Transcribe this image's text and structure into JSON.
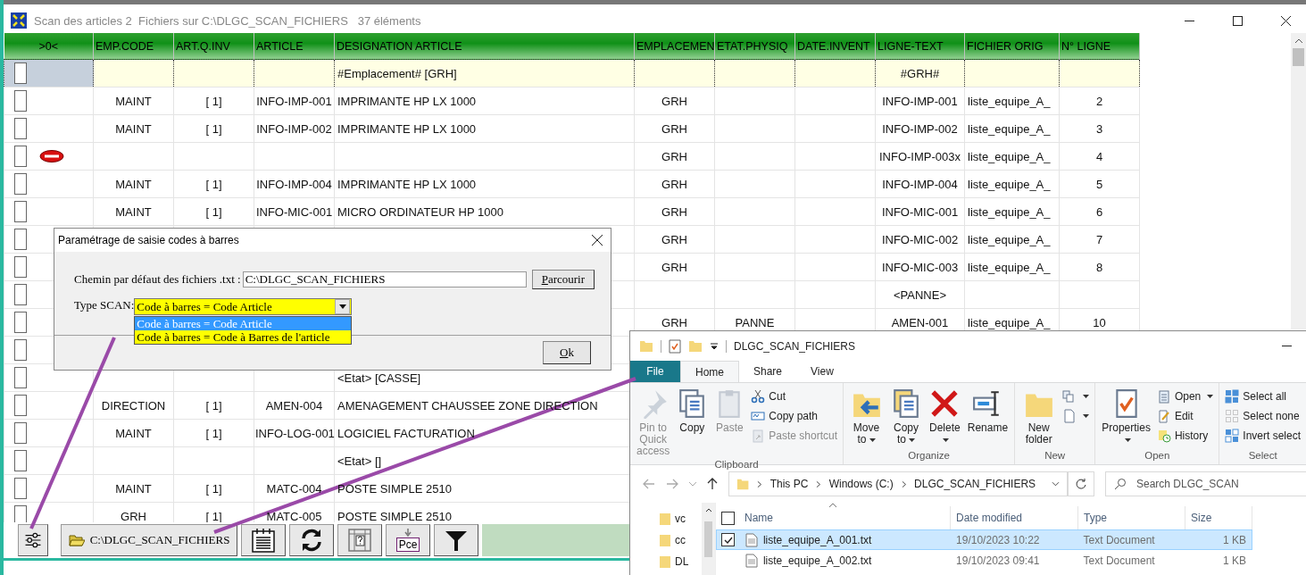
{
  "window": {
    "title": "Scan des articles 2  Fichiers sur C:\\DLGC_SCAN_FICHIERS   37 éléments"
  },
  "table": {
    "columns": [
      ">0<",
      "EMP.CODE",
      "ART.Q.INV",
      "ARTICLE",
      "DESIGNATION ARTICLE",
      "EMPLACEMEN",
      "ETAT.PHYSIQ",
      "DATE.INVENT",
      "LIGNE-TEXT",
      "FICHIER ORIG",
      "N° LIGNE"
    ],
    "rows": [
      {
        "kind": "location",
        "checked": false,
        "error": false,
        "cells": {
          "designation": "#Emplacement# [GRH]",
          "ligne": "#GRH#"
        }
      },
      {
        "kind": "item",
        "checked": false,
        "error": false,
        "cells": {
          "emp": "MAINT",
          "qty": "[ 1]",
          "article": "INFO-IMP-001",
          "designation": "IMPRIMANTE HP LX 1000",
          "place": "GRH",
          "ligne": "INFO-IMP-001",
          "file": "liste_equipe_A_",
          "num": "2"
        }
      },
      {
        "kind": "item",
        "checked": false,
        "error": false,
        "cells": {
          "emp": "MAINT",
          "qty": "[ 1]",
          "article": "INFO-IMP-002",
          "designation": "IMPRIMANTE HP LX 1000",
          "place": "GRH",
          "ligne": "INFO-IMP-002",
          "file": "liste_equipe_A_",
          "num": "3"
        }
      },
      {
        "kind": "item",
        "checked": false,
        "error": true,
        "cells": {
          "place": "GRH",
          "ligne": "INFO-IMP-003x",
          "file": "liste_equipe_A_",
          "num": "4"
        }
      },
      {
        "kind": "item",
        "checked": false,
        "error": false,
        "cells": {
          "emp": "MAINT",
          "qty": "[ 1]",
          "article": "INFO-IMP-004",
          "designation": "IMPRIMANTE HP LX 1000",
          "place": "GRH",
          "ligne": "INFO-IMP-004",
          "file": "liste_equipe_A_",
          "num": "5"
        }
      },
      {
        "kind": "item",
        "checked": false,
        "error": false,
        "cells": {
          "emp": "MAINT",
          "qty": "[ 1]",
          "article": "INFO-MIC-001",
          "designation": "MICRO ORDINATEUR HP 1000",
          "place": "GRH",
          "ligne": "INFO-MIC-001",
          "file": "liste_equipe_A_",
          "num": "6"
        }
      },
      {
        "kind": "item",
        "checked": false,
        "error": false,
        "cells": {
          "place": "GRH",
          "ligne": "INFO-MIC-002",
          "file": "liste_equipe_A_",
          "num": "7"
        }
      },
      {
        "kind": "item",
        "checked": false,
        "error": false,
        "cells": {
          "place": "GRH",
          "ligne": "INFO-MIC-003",
          "file": "liste_equipe_A_",
          "num": "8"
        }
      },
      {
        "kind": "item",
        "checked": false,
        "error": false,
        "cells": {
          "ligne": "<PANNE>"
        }
      },
      {
        "kind": "item",
        "checked": false,
        "error": false,
        "cells": {
          "place": "GRH",
          "state": "PANNE",
          "ligne": "AMEN-001",
          "file": "liste_equipe_A_",
          "num": "10"
        }
      },
      {
        "kind": "item",
        "checked": false,
        "error": false,
        "cells": {}
      },
      {
        "kind": "item",
        "checked": false,
        "error": false,
        "cells": {
          "designation": "<Etat> [CASSE]"
        }
      },
      {
        "kind": "item",
        "checked": false,
        "error": false,
        "cells": {
          "emp": "DIRECTION",
          "qty": "[ 1]",
          "article": "AMEN-004",
          "designation": "AMENAGEMENT CHAUSSEE ZONE DIRECTION"
        }
      },
      {
        "kind": "item",
        "checked": false,
        "error": false,
        "cells": {
          "emp": "MAINT",
          "qty": "[ 1]",
          "article": "INFO-LOG-001",
          "designation": "LOGICIEL FACTURATION"
        }
      },
      {
        "kind": "item",
        "checked": false,
        "error": false,
        "cells": {
          "designation": "<Etat> []"
        }
      },
      {
        "kind": "item",
        "checked": false,
        "error": false,
        "cells": {
          "emp": "MAINT",
          "qty": "[ 1]",
          "article": "MATC-004",
          "designation": "POSTE SIMPLE 2510"
        }
      },
      {
        "kind": "item",
        "checked": false,
        "error": false,
        "cells": {
          "emp": "GRH",
          "qty": "[ 1]",
          "article": "MATC-005",
          "designation": "POSTE SIMPLE 2510"
        }
      }
    ]
  },
  "toolbar": [
    {
      "kind": "settings"
    },
    {
      "kind": "path",
      "label": "C:\\DLGC_SCAN_FICHIERS"
    },
    {
      "kind": "notes"
    },
    {
      "kind": "refresh"
    },
    {
      "kind": "grid-help"
    },
    {
      "kind": "piece",
      "label": "Pce"
    },
    {
      "kind": "filter"
    }
  ],
  "dialog": {
    "title": "Paramétrage de saisie codes à barres",
    "path_label": "Chemin par défaut des fichiers .txt :",
    "path_value": "C:\\DLGC_SCAN_FICHIERS",
    "browse_button": "Parcourir",
    "type_label": "Type SCAN:",
    "type_value": "Code à barres = Code Article",
    "options": [
      {
        "label": "Code à barres = Code Article",
        "selected": true
      },
      {
        "label": "Code à barres = Code à Barres de l'article",
        "selected": false
      }
    ],
    "ok_button": "Ok"
  },
  "explorer": {
    "title": "DLGC_SCAN_FICHIERS",
    "tabs": [
      {
        "label": "File",
        "kind": "file-menu",
        "selected": false
      },
      {
        "label": "Home",
        "kind": "tab",
        "selected": true
      },
      {
        "label": "Share",
        "kind": "tab",
        "selected": false
      },
      {
        "label": "View",
        "kind": "tab",
        "selected": false
      }
    ],
    "groups": [
      {
        "label": "Clipboard",
        "buttons": [
          {
            "kind": "pin",
            "label": "Pin to Quick access",
            "disabled": true,
            "dropdown": false
          },
          {
            "kind": "copy",
            "label": "Copy",
            "disabled": false,
            "dropdown": false
          },
          {
            "kind": "paste",
            "label": "Paste",
            "disabled": true,
            "dropdown": false
          }
        ],
        "small_buttons": [
          {
            "kind": "cut",
            "label": "Cut",
            "disabled": false,
            "dropdown": false
          },
          {
            "kind": "copy-path",
            "label": "Copy path",
            "disabled": false,
            "dropdown": false
          },
          {
            "kind": "paste-shortcut",
            "label": "Paste shortcut",
            "disabled": true,
            "dropdown": false
          }
        ]
      },
      {
        "label": "Organize",
        "buttons": [
          {
            "kind": "move",
            "label": "Move to",
            "dropdown": true,
            "disabled": false
          },
          {
            "kind": "copyto",
            "label": "Copy to",
            "dropdown": true,
            "disabled": false
          },
          {
            "kind": "delete",
            "label": "Delete",
            "dropdown": true,
            "disabled": false
          },
          {
            "kind": "rename",
            "label": "Rename",
            "disabled": false,
            "dropdown": false
          }
        ]
      },
      {
        "label": "New",
        "buttons": [
          {
            "kind": "folder",
            "label": "New folder",
            "disabled": false,
            "dropdown": false
          }
        ],
        "small_buttons": [
          {
            "kind": "new-item",
            "dropdown": true,
            "disabled": false
          },
          {
            "kind": "easy-access",
            "dropdown": true,
            "disabled": false
          }
        ]
      },
      {
        "label": "Open",
        "buttons": [
          {
            "kind": "properties",
            "label": "Properties",
            "dropdown": true,
            "disabled": false
          }
        ],
        "small_buttons": [
          {
            "kind": "open",
            "label": "Open",
            "dropdown": true,
            "disabled": false
          },
          {
            "kind": "edit",
            "label": "Edit",
            "disabled": false,
            "dropdown": false
          },
          {
            "kind": "history",
            "label": "History",
            "disabled": false,
            "dropdown": false
          }
        ]
      },
      {
        "label": "Select",
        "small_buttons": [
          {
            "kind": "select-all",
            "label": "Select all",
            "disabled": false,
            "dropdown": false
          },
          {
            "kind": "select-none",
            "label": "Select none",
            "disabled": false,
            "dropdown": false
          },
          {
            "kind": "invert",
            "label": "Invert select",
            "disabled": false,
            "dropdown": false
          }
        ]
      }
    ],
    "breadcrumb": [
      "This PC",
      "Windows (C:)",
      "DLGC_SCAN_FICHIERS"
    ],
    "search": {
      "placeholder": "Search DLGC_SCAN"
    },
    "nav": [
      "vc",
      "cc",
      "DL"
    ],
    "columns": [
      "Name",
      "Date modified",
      "Type",
      "Size"
    ],
    "all_checked": false,
    "files": [
      {
        "name": "liste_equipe_A_001.txt",
        "date": "19/10/2023 10:22",
        "type": "Text Document",
        "size": "1 KB",
        "selected": true,
        "checked": true
      },
      {
        "name": "liste_equipe_A_002.txt",
        "date": "19/10/2023 09:41",
        "type": "Text Document",
        "size": "1 KB",
        "selected": false,
        "checked": false
      }
    ]
  }
}
